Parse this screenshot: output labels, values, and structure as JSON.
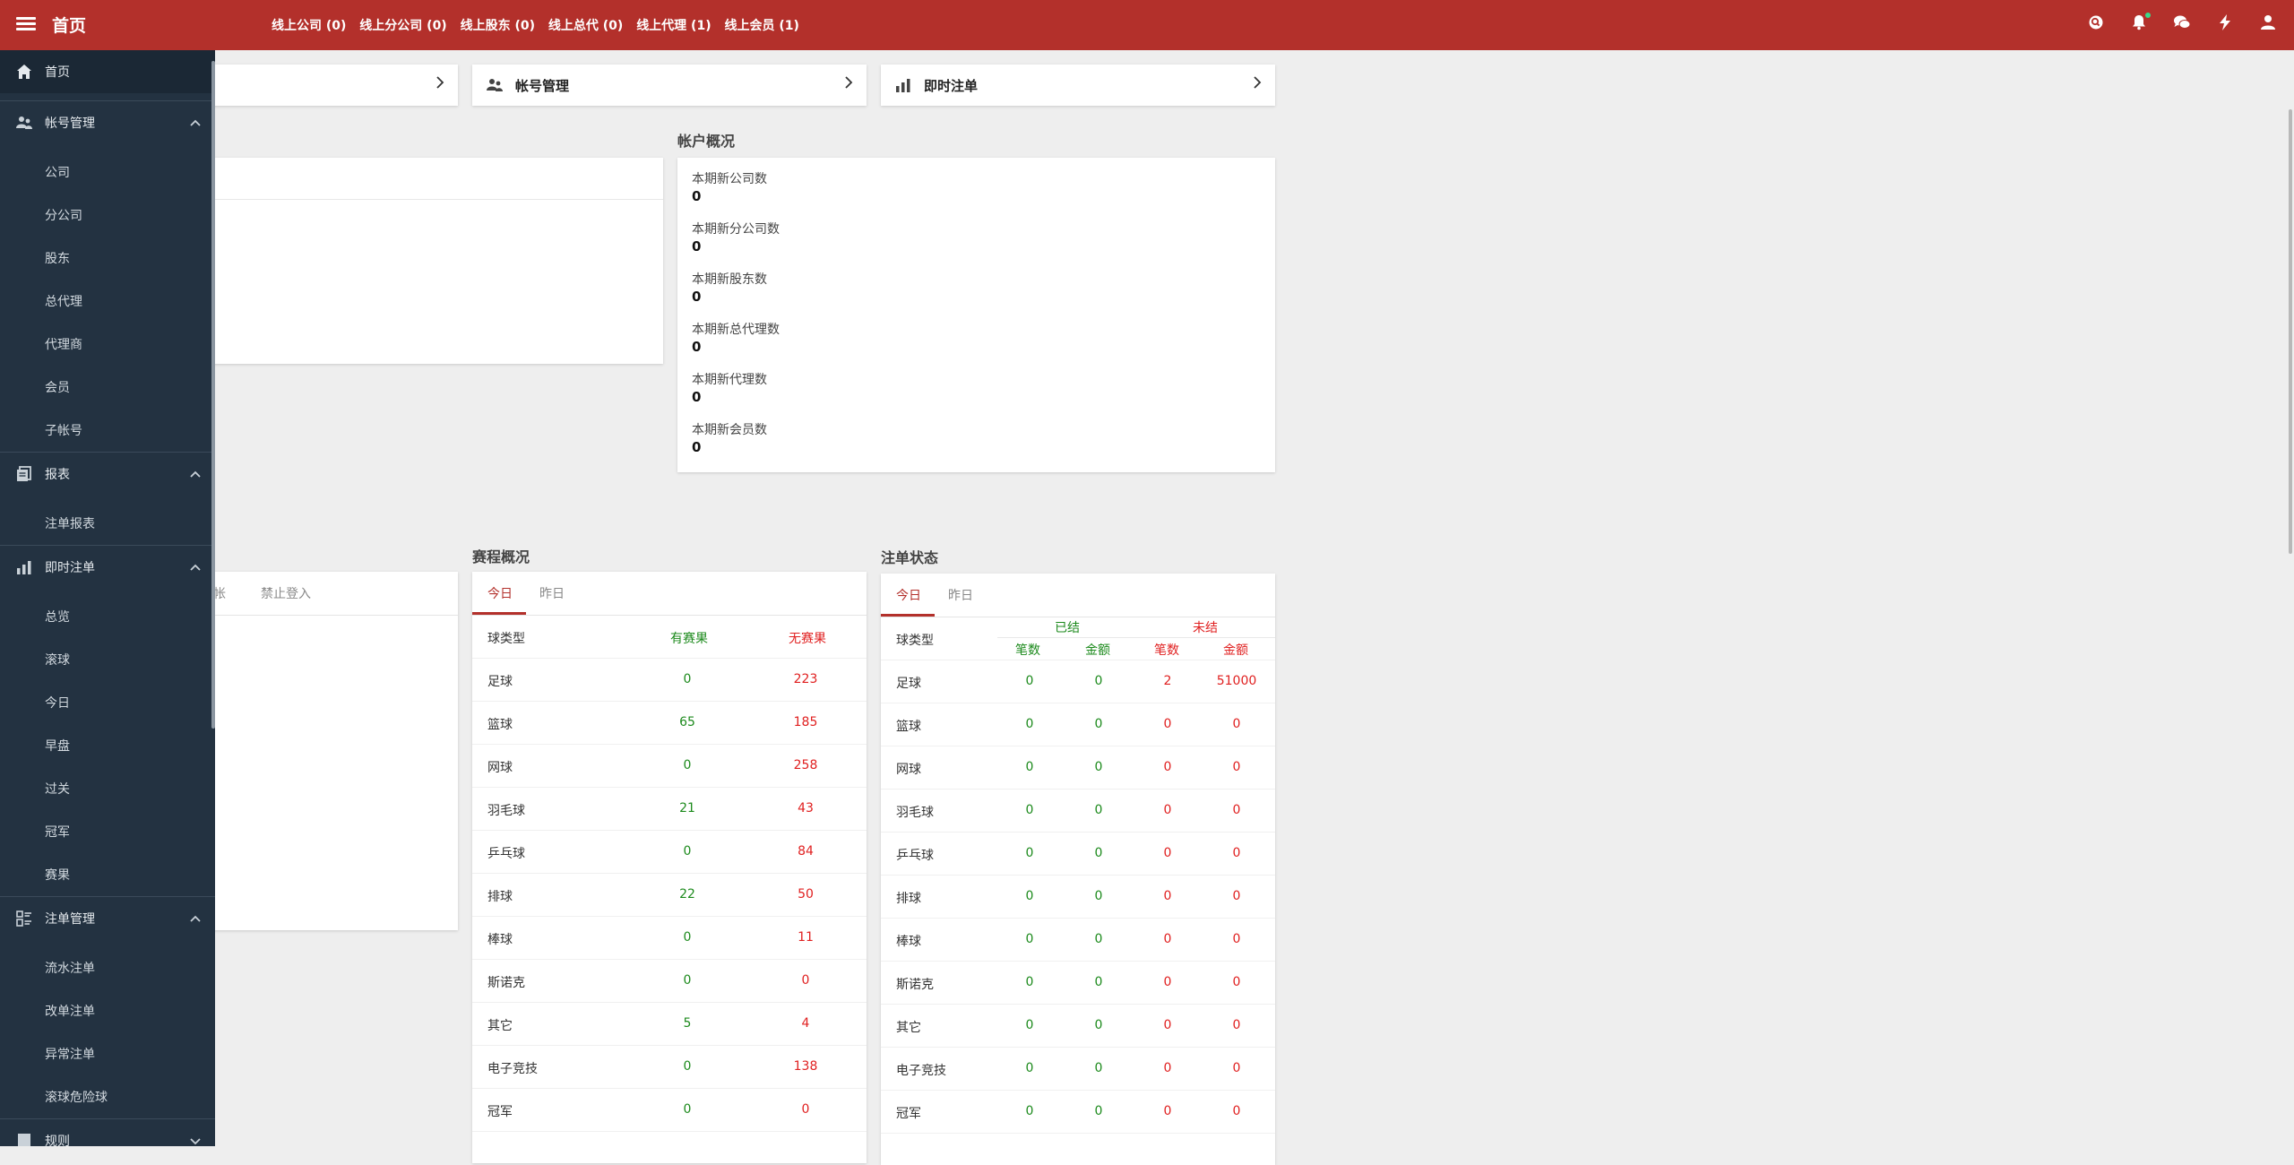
{
  "header": {
    "title": "首页",
    "online": [
      "线上公司 (0)",
      "线上分公司 (0)",
      "线上股东 (0)",
      "线上总代 (0)",
      "线上代理 (1)",
      "线上会员 (1)"
    ],
    "icons": [
      "search-icon",
      "bell-icon",
      "chat-icon",
      "flash-icon",
      "user-icon"
    ]
  },
  "sidebar": {
    "home": "首页",
    "groups": [
      {
        "label": "帐号管理",
        "icon": "users-icon",
        "items": [
          "公司",
          "分公司",
          "股东",
          "总代理",
          "代理商",
          "会员",
          "子帐号"
        ]
      },
      {
        "label": "报表",
        "icon": "report-icon",
        "items": [
          "注单报表"
        ]
      },
      {
        "label": "即时注单",
        "icon": "bar-chart-icon",
        "items": [
          "总览",
          "滚球",
          "今日",
          "早盘",
          "过关",
          "冠军",
          "赛果"
        ]
      },
      {
        "label": "注单管理",
        "icon": "list-icon",
        "items": [
          "流水注单",
          "改单注单",
          "异常注单",
          "滚球危险球"
        ]
      },
      {
        "label": "规则",
        "icon": "book-icon",
        "items": []
      }
    ]
  },
  "quick_links": [
    {
      "label": "帐号管理",
      "icon": "users-icon"
    },
    {
      "label": "即时注单",
      "icon": "bar-chart-icon"
    }
  ],
  "account_overview": {
    "title": "帐户概况",
    "items": [
      {
        "label": "本期新公司数",
        "value": "0"
      },
      {
        "label": "本期新分公司数",
        "value": "0"
      },
      {
        "label": "本期新股东数",
        "value": "0"
      },
      {
        "label": "本期新总代理数",
        "value": "0"
      },
      {
        "label": "本期新代理数",
        "value": "0"
      },
      {
        "label": "本期新会员数",
        "value": "0"
      }
    ]
  },
  "member_status": {
    "tabs": [
      "帐",
      "禁止登入"
    ]
  },
  "schedule": {
    "title": "赛程概况",
    "tabs": [
      "今日",
      "昨日"
    ],
    "headers": [
      "球类型",
      "有赛果",
      "无赛果"
    ],
    "rows": [
      [
        "足球",
        "0",
        "223"
      ],
      [
        "篮球",
        "65",
        "185"
      ],
      [
        "网球",
        "0",
        "258"
      ],
      [
        "羽毛球",
        "21",
        "43"
      ],
      [
        "乒乓球",
        "0",
        "84"
      ],
      [
        "排球",
        "22",
        "50"
      ],
      [
        "棒球",
        "0",
        "11"
      ],
      [
        "斯诺克",
        "0",
        "0"
      ],
      [
        "其它",
        "5",
        "4"
      ],
      [
        "电子竞技",
        "0",
        "138"
      ],
      [
        "冠军",
        "0",
        "0"
      ]
    ]
  },
  "bet_status": {
    "title": "注单状态",
    "tabs": [
      "今日",
      "昨日"
    ],
    "type_header": "球类型",
    "settled": "已结",
    "unsettled": "未结",
    "sub_headers": [
      "笔数",
      "金额",
      "笔数",
      "金额"
    ],
    "rows": [
      [
        "足球",
        "0",
        "0",
        "2",
        "51000"
      ],
      [
        "篮球",
        "0",
        "0",
        "0",
        "0"
      ],
      [
        "网球",
        "0",
        "0",
        "0",
        "0"
      ],
      [
        "羽毛球",
        "0",
        "0",
        "0",
        "0"
      ],
      [
        "乒乓球",
        "0",
        "0",
        "0",
        "0"
      ],
      [
        "排球",
        "0",
        "0",
        "0",
        "0"
      ],
      [
        "棒球",
        "0",
        "0",
        "0",
        "0"
      ],
      [
        "斯诺克",
        "0",
        "0",
        "0",
        "0"
      ],
      [
        "其它",
        "0",
        "0",
        "0",
        "0"
      ],
      [
        "电子竞技",
        "0",
        "0",
        "0",
        "0"
      ],
      [
        "冠军",
        "0",
        "0",
        "0",
        "0"
      ]
    ]
  }
}
